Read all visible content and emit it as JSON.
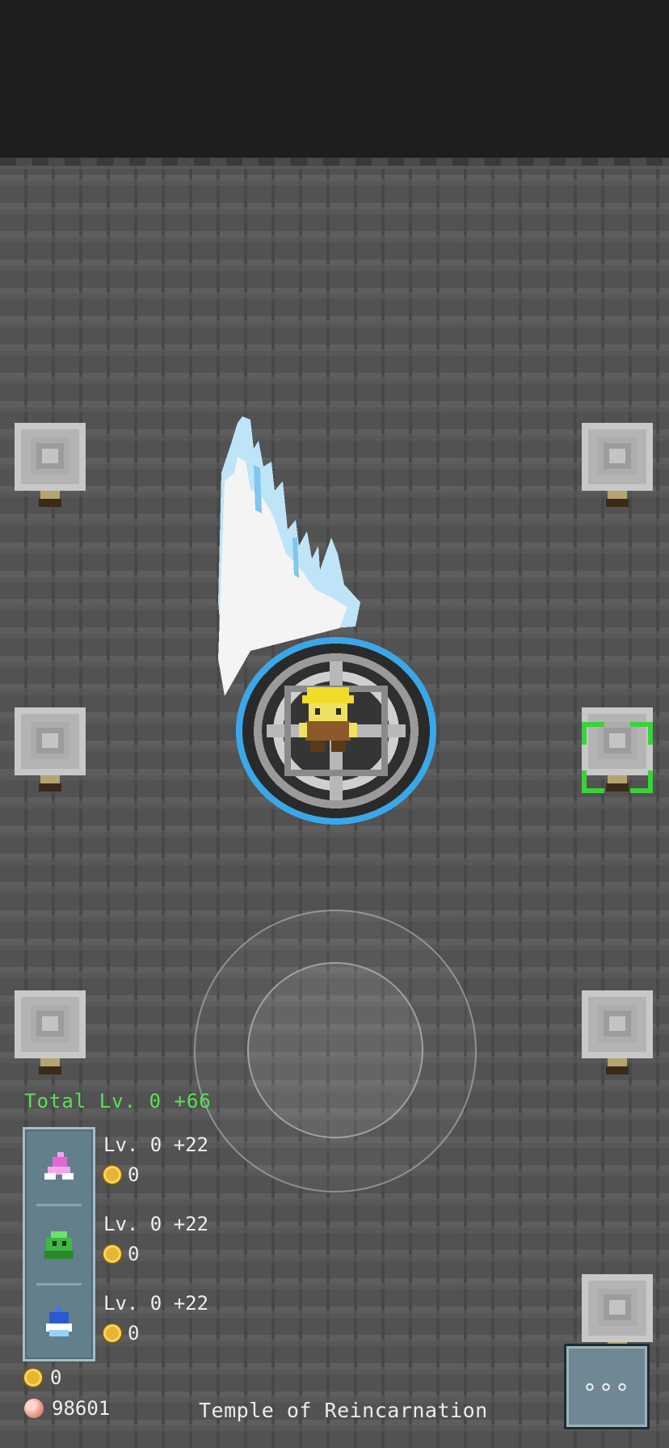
{
  "hud": {
    "total_level": "Total Lv. 0 +66",
    "skills": [
      {
        "icon": "pink-spirit-icon",
        "level": "Lv. 0 +22",
        "cost": "0"
      },
      {
        "icon": "green-slime-icon",
        "level": "Lv. 0 +22",
        "cost": "0"
      },
      {
        "icon": "blue-flame-icon",
        "level": "Lv. 0 +22",
        "cost": "0"
      }
    ],
    "gold": "0",
    "gems": "98601",
    "location": "Temple of Reincarnation",
    "more_label": "∘∘∘"
  },
  "colors": {
    "total_level": "#5ae05a",
    "panel": "#647f8c",
    "portal_ring": "#3aa8e8",
    "hero_hair": "#f2dc2a",
    "selection": "#3ad13a"
  },
  "icons": [
    "pillar-lamp-icon",
    "wing-icon",
    "portal-icon",
    "hero-icon",
    "coin-icon",
    "gem-icon",
    "more-icon"
  ]
}
